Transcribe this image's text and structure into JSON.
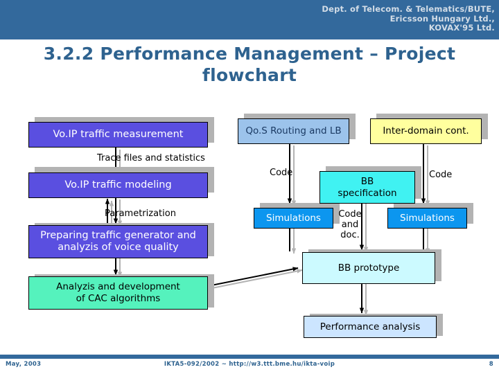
{
  "header": {
    "affiliation": "Dept. of Telecom. & Telematics/BUTE,\nEricsson Hungary Ltd.,\nKOVAX'95 Ltd.",
    "band_color": "#33699c"
  },
  "title": {
    "text": "3.2.2 Performance Management –\nProject flowchart",
    "color": "#2e628f"
  },
  "chart_data": {
    "type": "diagram",
    "title": "3.2.2 Performance Management – Project flowchart",
    "nodes": [
      {
        "id": "voip-measurement",
        "label": "Vo.IP traffic measurement",
        "color": "#5a4fe0",
        "text_color": "#ffffff"
      },
      {
        "id": "qos-routing",
        "label": "Qo.S Routing and LB",
        "color": "#9cc3eb",
        "text_color": "#1b3a63"
      },
      {
        "id": "inter-domain",
        "label": "Inter-domain cont.",
        "color": "#ffff9e",
        "text_color": "#000000"
      },
      {
        "id": "voip-modeling",
        "label": "Vo.IP traffic modeling",
        "color": "#5a4fe0",
        "text_color": "#ffffff"
      },
      {
        "id": "bb-specification",
        "label": "BB\nspecification",
        "color": "#40f2f2",
        "text_color": "#000000"
      },
      {
        "id": "simulations-left",
        "label": "Simulations",
        "color": "#0c96ef",
        "text_color": "#ffffff"
      },
      {
        "id": "simulations-right",
        "label": "Simulations",
        "color": "#0c96ef",
        "text_color": "#ffffff"
      },
      {
        "id": "traffic-generator",
        "label": "Preparing traffic generator and\nanalyzis of voice quality",
        "color": "#5a4fe0",
        "text_color": "#ffffff"
      },
      {
        "id": "bb-prototype",
        "label": "BB prototype",
        "color": "#ccfaff",
        "text_color": "#000000"
      },
      {
        "id": "cac-algorithms",
        "label": "Analyzis and development\nof CAC algorithms",
        "color": "#55f2bd",
        "text_color": "#000000"
      },
      {
        "id": "performance-analysis",
        "label": "Performance analysis",
        "color": "#cce5ff",
        "text_color": "#000000"
      }
    ],
    "edges": [
      {
        "from": "voip-measurement",
        "to": "voip-modeling",
        "label": "Trace files and statistics"
      },
      {
        "from": "voip-modeling",
        "to": "traffic-generator",
        "label": "Parametrization",
        "bidirectional": true
      },
      {
        "from": "traffic-generator",
        "to": "cac-algorithms",
        "label": ""
      },
      {
        "from": "qos-routing",
        "to": "simulations-left",
        "label": "Code"
      },
      {
        "from": "inter-domain",
        "to": "simulations-right",
        "label": "Code"
      },
      {
        "from": "bb-specification",
        "to": "bb-prototype",
        "label": "Code\nand\ndoc."
      },
      {
        "from": "simulations-left",
        "to": "bb-prototype",
        "label": "",
        "bidirectional": true
      },
      {
        "from": "simulations-right",
        "to": "bb-prototype",
        "label": "",
        "bidirectional": true
      },
      {
        "from": "cac-algorithms",
        "to": "bb-prototype",
        "label": ""
      },
      {
        "from": "bb-prototype",
        "to": "performance-analysis",
        "label": ""
      }
    ],
    "edge_labels": {
      "trace_files": "Trace files and statistics",
      "parametrization": "Parametrization",
      "code_left": "Code",
      "code_right": "Code",
      "code_and_doc": "Code\nand\ndoc."
    }
  },
  "footer": {
    "left": "May, 2003",
    "center": "IKTA5-092/2002 ~ http://w3.ttt.bme.hu/ikta-voip",
    "right": "8"
  }
}
